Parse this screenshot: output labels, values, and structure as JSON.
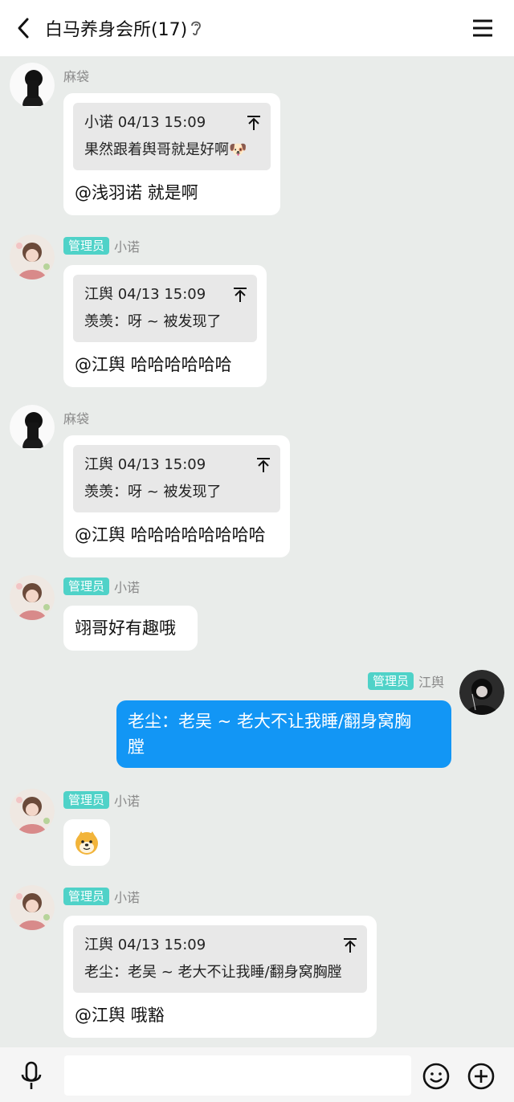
{
  "header": {
    "title": "白马养身会所(17)"
  },
  "messages": [
    {
      "sender": "麻袋",
      "quote": {
        "author_time": "小诺 04/13 15:09",
        "text": "果然跟着舆哥就是好啊"
      },
      "text": "@浅羽诺 就是啊"
    },
    {
      "badge": "管理员",
      "sender": "小诺",
      "quote": {
        "author_time": "江舆 04/13 15:09",
        "text": "羡羡：呀 ~ 被发现了"
      },
      "text": "@江舆 哈哈哈哈哈哈"
    },
    {
      "sender": "麻袋",
      "quote": {
        "author_time": "江舆 04/13 15:09",
        "text": "羡羡：呀 ~ 被发现了"
      },
      "text": "@江舆 哈哈哈哈哈哈哈哈"
    },
    {
      "badge": "管理员",
      "sender": "小诺",
      "text": "翊哥好有趣哦"
    },
    {
      "badge": "管理员",
      "sender": "江舆",
      "text_line1": "老尘：老吴 ~ 老大不让我睡/翻身窝胸",
      "text_line2": "膛"
    },
    {
      "badge": "管理员",
      "sender": "小诺",
      "emoji": "doge-emoji"
    },
    {
      "badge": "管理员",
      "sender": "小诺",
      "quote": {
        "author_time": "江舆 04/13 15:09",
        "text": "老尘：老吴 ~ 老大不让我睡/翻身窝胸膛"
      },
      "text": "@江舆 哦豁"
    }
  ],
  "icons": {
    "back": "back-arrow-icon",
    "ear": "ear-icon",
    "menu": "hamburger-menu-icon",
    "pin": "pin-to-top-icon",
    "mic": "microphone-icon",
    "emoji": "smiley-face-icon",
    "plus": "plus-circle-icon"
  },
  "colors": {
    "background": "#e9ecea",
    "badge": "#4fd2c8",
    "my_bubble": "#1296f5",
    "quote_bg": "#e8e8e8"
  }
}
